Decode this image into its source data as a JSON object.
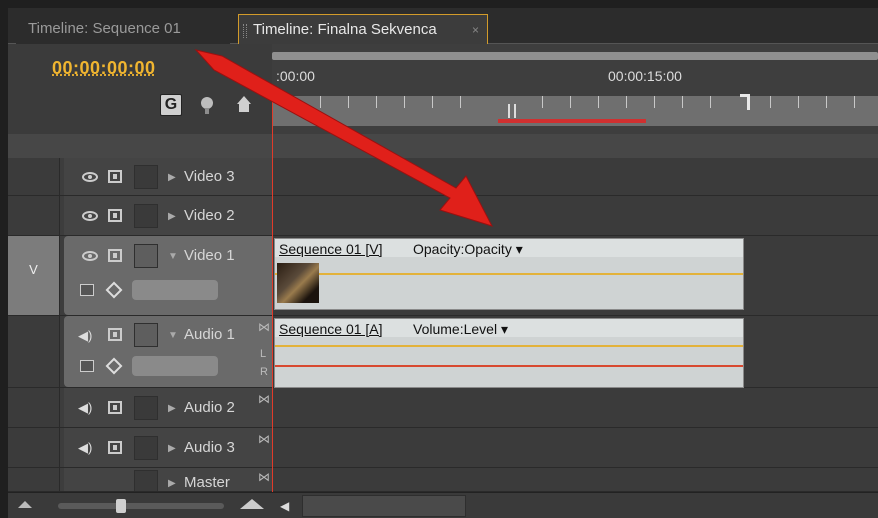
{
  "tabs": [
    {
      "label": "Timeline: Sequence 01",
      "active": false
    },
    {
      "label": "Timeline: Finalna Sekvenca",
      "active": true,
      "close": "×"
    }
  ],
  "timecode": "00:00:00:00",
  "ruler": {
    "start_label": ":00:00",
    "mid_label": "00:00:15:00"
  },
  "tracks": [
    {
      "name": "Video 3",
      "kind": "video"
    },
    {
      "name": "Video 2",
      "kind": "video"
    },
    {
      "name": "Video 1",
      "kind": "video",
      "target": "V"
    },
    {
      "name": "Audio 1",
      "kind": "audio",
      "lr_top": "L",
      "lr_bottom": "R"
    },
    {
      "name": "Audio 2",
      "kind": "audio"
    },
    {
      "name": "Audio 3",
      "kind": "audio"
    },
    {
      "name": "Master",
      "kind": "audio"
    }
  ],
  "clips": {
    "video": {
      "name": "Sequence 01 [V]",
      "mode": "Opacity:Opacity ▾"
    },
    "audio": {
      "name": "Sequence 01 [A]",
      "mode": "Volume:Level ▾"
    }
  },
  "colors": {
    "timecode": "#f0b530",
    "playhead": "#e03b2a",
    "arrow": "#e0201a"
  }
}
